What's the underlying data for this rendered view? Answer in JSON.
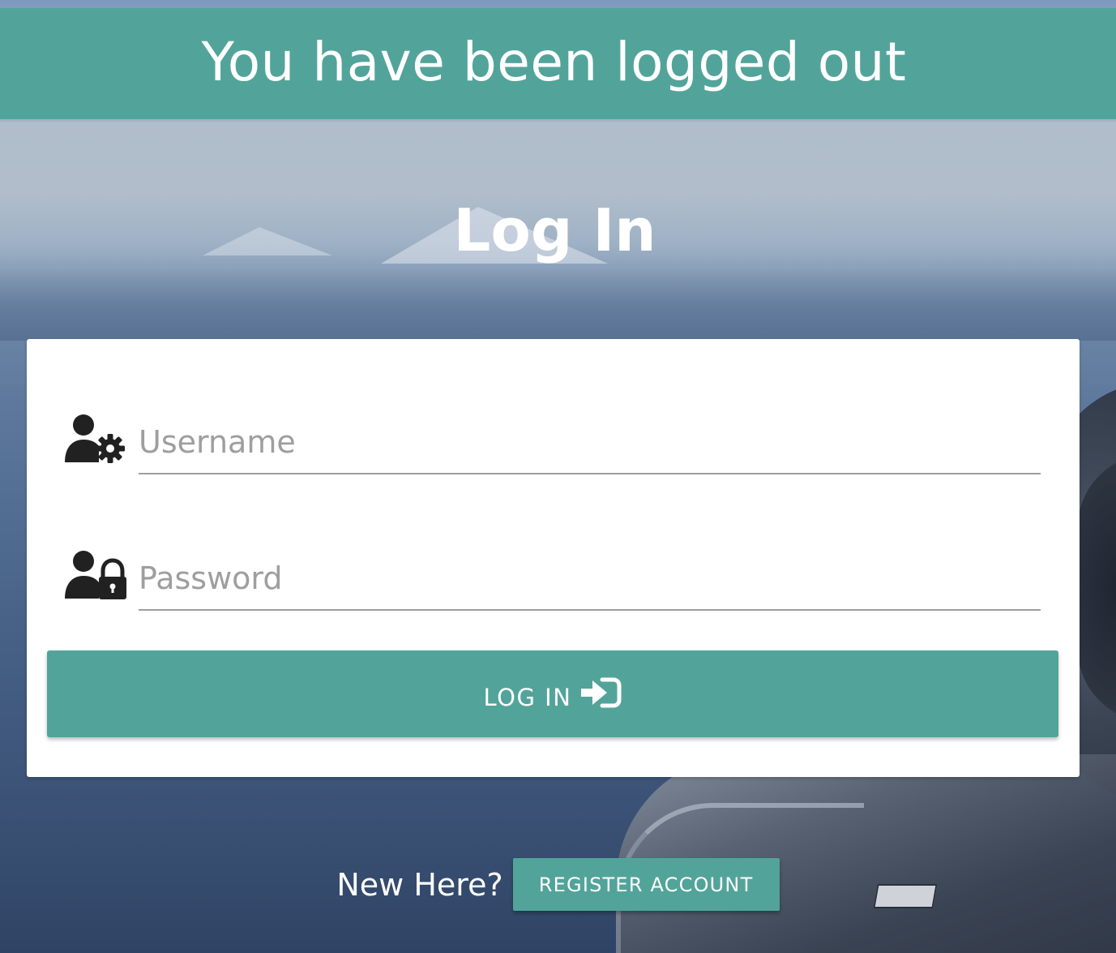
{
  "banner": {
    "message": "You have been logged out"
  },
  "heading": {
    "title": "Log In"
  },
  "form": {
    "username": {
      "placeholder": "Username",
      "value": "",
      "icon": "user-gear-icon"
    },
    "password": {
      "placeholder": "Password",
      "value": "",
      "icon": "user-lock-icon"
    },
    "submit": {
      "label": "LOG IN",
      "icon": "sign-in-icon"
    }
  },
  "register": {
    "prompt": "New Here?",
    "button_label": "REGISTER ACCOUNT"
  },
  "colors": {
    "accent": "#52a49a",
    "card": "#ffffff",
    "icon": "#212121",
    "placeholder": "#9e9e9e"
  }
}
